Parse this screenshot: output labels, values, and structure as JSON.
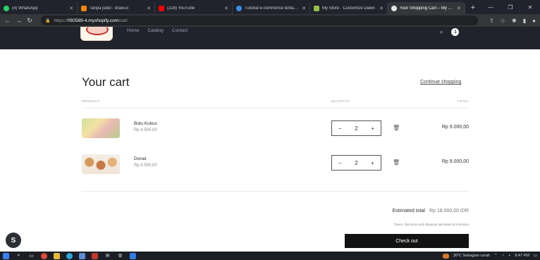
{
  "browser": {
    "tabs": [
      {
        "title": "(4) WhatsApp",
        "color": "#25d366"
      },
      {
        "title": "Tanpa judul - draw.io",
        "color": "#f08705"
      },
      {
        "title": "(228) YouTube",
        "color": "#ff0000"
      },
      {
        "title": "Tutorial e-commerce tentang...",
        "color": "#3a8ee6"
      },
      {
        "title": "My Store · Customize Dawn",
        "color": "#95bf47"
      },
      {
        "title": "Your Shopping Cart – My Store",
        "color": "#ffffff",
        "active": true
      }
    ],
    "new_tab_label": "+",
    "url_scheme": "https://",
    "url_host": "092589-4.myshopify.com",
    "url_path": "/cart"
  },
  "store": {
    "nav": [
      "Home",
      "Catalog",
      "Contact"
    ],
    "cart_count": "1"
  },
  "cart": {
    "title": "Your cart",
    "continue_label": "Continue shopping",
    "col_product": "PRODUCT",
    "col_quantity": "QUANTITY",
    "col_total": "TOTAL",
    "items": [
      {
        "name": "Bolu Kukus",
        "price": "Rp 4.500,00",
        "qty": "2",
        "total": "Rp 9.000,00",
        "image": "bolu-kukus"
      },
      {
        "name": "Donat",
        "price": "Rp 4.500,00",
        "qty": "2",
        "total": "Rp 9.000,00",
        "image": "donat"
      }
    ],
    "estimated_label": "Estimated total",
    "estimated_value": "Rp 18.000,00 IDR",
    "taxes_note": "Taxes, discounts and shipping calculated at checkout",
    "checkout_label": "Check out",
    "minus": "−",
    "plus": "+"
  },
  "taskbar": {
    "weather": "30°C  Sebagian cerah",
    "time": "9:47 PM"
  }
}
